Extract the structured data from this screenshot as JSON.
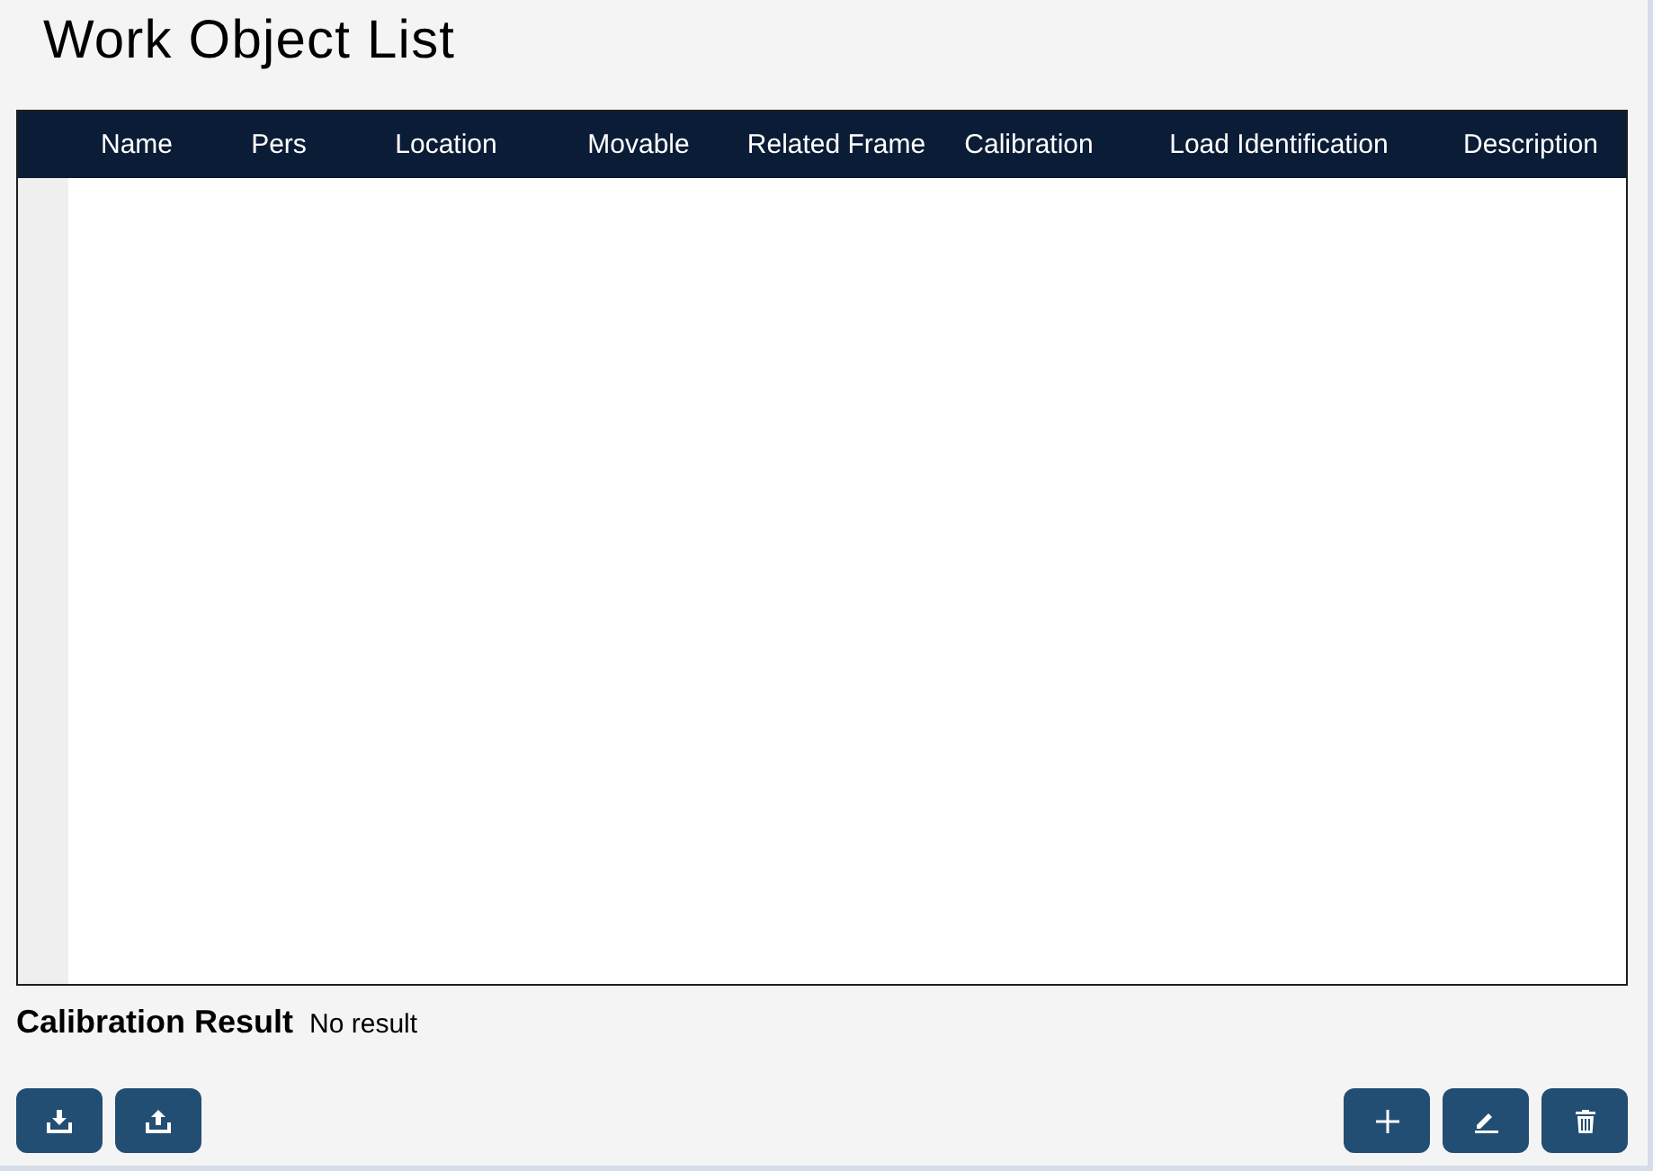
{
  "title": "Work Object List",
  "table": {
    "columns": [
      "Name",
      "Pers",
      "Location",
      "Movable",
      "Related Frame",
      "Calibration",
      "Load Identification",
      "Description"
    ]
  },
  "calibration_result": {
    "label": "Calibration Result",
    "value": "No result"
  }
}
